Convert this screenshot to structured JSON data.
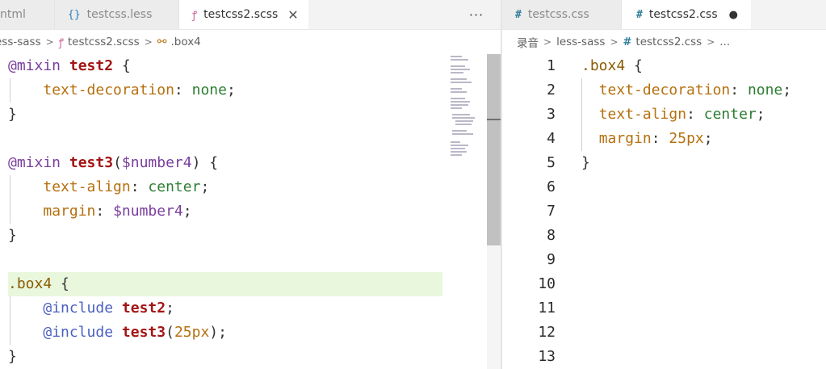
{
  "left_tabs": [
    {
      "icon": "",
      "label": "ntml",
      "state": "inactive"
    },
    {
      "icon": "{}",
      "label": "testcss.less",
      "state": "inactive"
    },
    {
      "icon": "ꝭ",
      "label": "testcss2.scss",
      "state": "active",
      "close": "✕"
    }
  ],
  "left_more": "···",
  "left_breadcrumb": [
    "ess-sass",
    "testcss2.scss",
    ".box4"
  ],
  "left_code": [
    [
      [
        "@mixin",
        "t-at"
      ],
      [
        " ",
        "t-punc"
      ],
      [
        "test2",
        "t-name"
      ],
      [
        " {",
        "t-punc"
      ]
    ],
    [
      [
        "    ",
        "t-punc"
      ],
      [
        "text-decoration",
        "t-prop"
      ],
      [
        ": ",
        "t-punc"
      ],
      [
        "none",
        "t-val"
      ],
      [
        ";",
        "t-punc"
      ]
    ],
    [
      [
        "}",
        "t-punc"
      ]
    ],
    [],
    [
      [
        "@mixin",
        "t-at"
      ],
      [
        " ",
        "t-punc"
      ],
      [
        "test3",
        "t-name"
      ],
      [
        "(",
        "t-punc"
      ],
      [
        "$number4",
        "t-var"
      ],
      [
        ") {",
        "t-punc"
      ]
    ],
    [
      [
        "    ",
        "t-punc"
      ],
      [
        "text-align",
        "t-prop"
      ],
      [
        ": ",
        "t-punc"
      ],
      [
        "center",
        "t-val"
      ],
      [
        ";",
        "t-punc"
      ]
    ],
    [
      [
        "    ",
        "t-punc"
      ],
      [
        "margin",
        "t-prop"
      ],
      [
        ": ",
        "t-punc"
      ],
      [
        "$number4",
        "t-var"
      ],
      [
        ";",
        "t-punc"
      ]
    ],
    [
      [
        "}",
        "t-punc"
      ]
    ],
    [],
    [
      [
        ".box4",
        "t-sel"
      ],
      [
        " {",
        "t-punc"
      ]
    ],
    [
      [
        "    ",
        "t-punc"
      ],
      [
        "@include",
        "t-inc"
      ],
      [
        " ",
        "t-punc"
      ],
      [
        "test2",
        "t-name"
      ],
      [
        ";",
        "t-punc"
      ]
    ],
    [
      [
        "    ",
        "t-punc"
      ],
      [
        "@include",
        "t-inc"
      ],
      [
        " ",
        "t-punc"
      ],
      [
        "test3",
        "t-name"
      ],
      [
        "(",
        "t-punc"
      ],
      [
        "25px",
        "t-num"
      ],
      [
        ");",
        "t-punc"
      ]
    ],
    [
      [
        "}",
        "t-punc"
      ]
    ]
  ],
  "right_tabs": [
    {
      "icon": "#",
      "label": "testcss.css",
      "state": "inactive"
    },
    {
      "icon": "#",
      "label": "testcss2.css",
      "state": "active",
      "dirty": "●"
    }
  ],
  "right_breadcrumb": [
    "录音",
    "less-sass",
    "testcss2.css",
    "..."
  ],
  "right_line_numbers": [
    "1",
    "2",
    "3",
    "4",
    "5",
    "6",
    "7",
    "8",
    "9",
    "10",
    "11",
    "12",
    "13"
  ],
  "right_code": [
    [
      [
        ".box4",
        "t-sel"
      ],
      [
        " {",
        "t-punc"
      ]
    ],
    [
      [
        "  ",
        "t-punc"
      ],
      [
        "text-decoration",
        "t-prop"
      ],
      [
        ": ",
        "t-punc"
      ],
      [
        "none",
        "t-val"
      ],
      [
        ";",
        "t-punc"
      ]
    ],
    [
      [
        "  ",
        "t-punc"
      ],
      [
        "text-align",
        "t-prop"
      ],
      [
        ": ",
        "t-punc"
      ],
      [
        "center",
        "t-val"
      ],
      [
        ";",
        "t-punc"
      ]
    ],
    [
      [
        "  ",
        "t-punc"
      ],
      [
        "margin",
        "t-prop"
      ],
      [
        ": ",
        "t-punc"
      ],
      [
        "25px",
        "t-num"
      ],
      [
        ";",
        "t-punc"
      ]
    ],
    [
      [
        "}",
        "t-punc"
      ]
    ]
  ],
  "colors": {
    "less_icon": "#2c7fb8",
    "scss_icon": "#cd6799",
    "css_icon": "#2e7d9a",
    "highlight": "#e9f7dd"
  }
}
